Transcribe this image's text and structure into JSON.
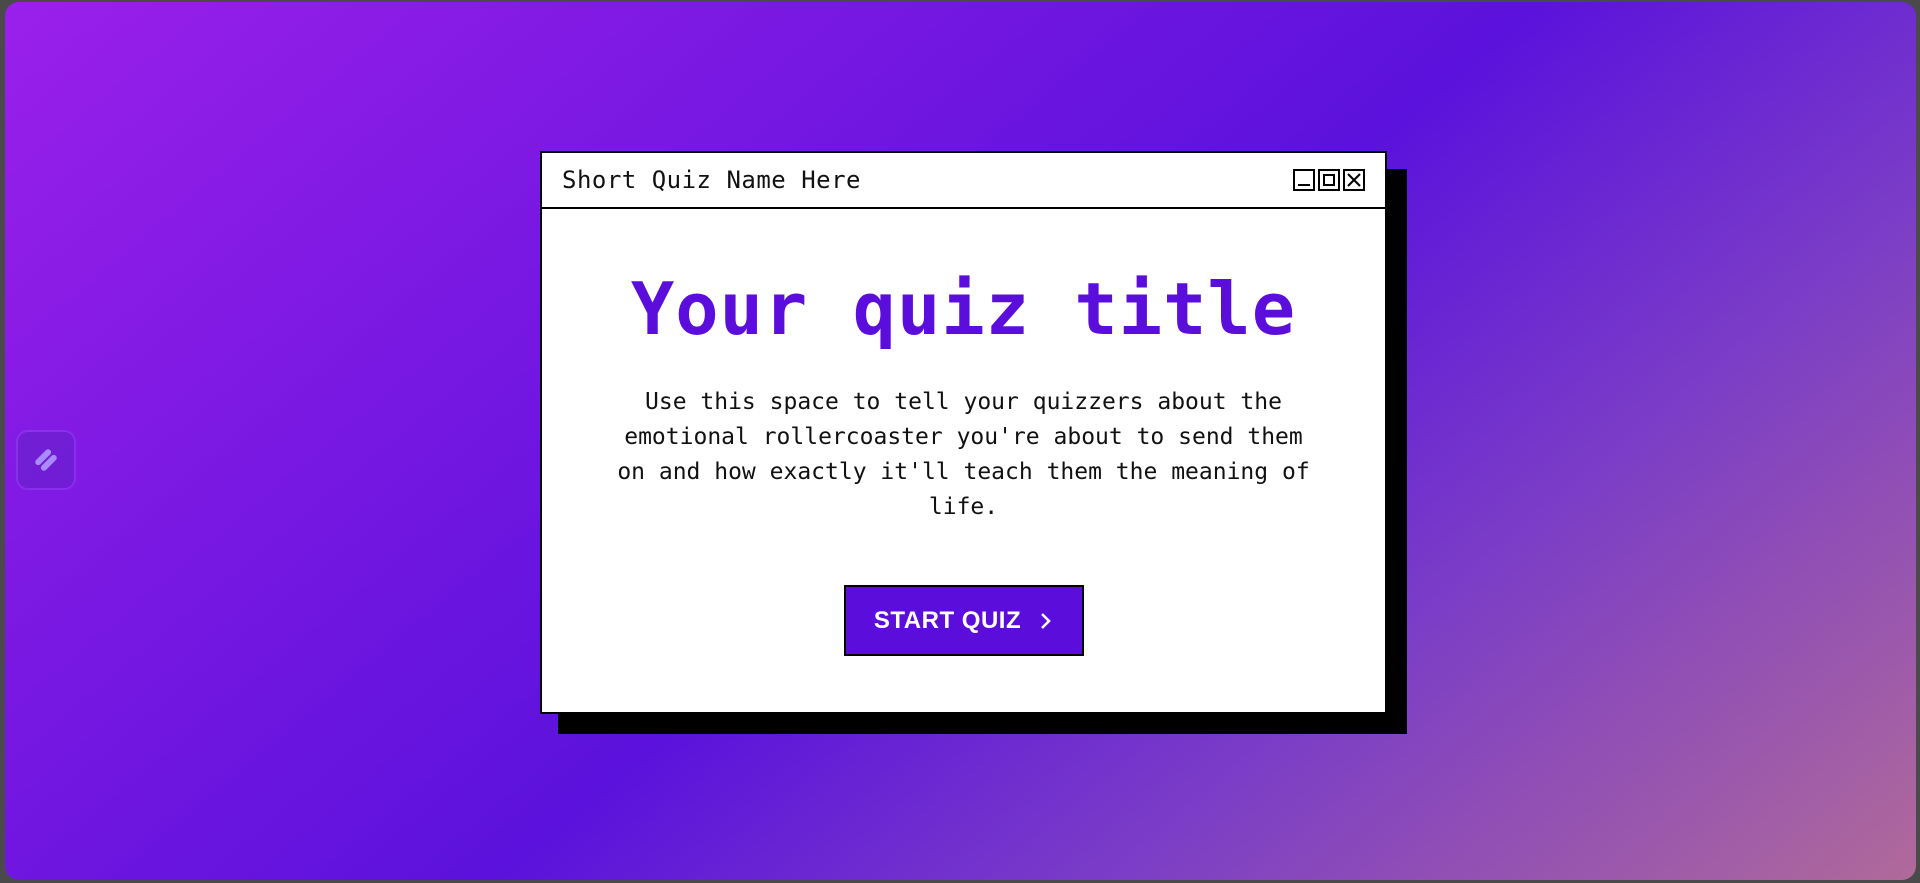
{
  "window": {
    "title": "Short Quiz Name Here",
    "controls": [
      "minimize-icon",
      "maximize-icon",
      "close-icon"
    ]
  },
  "quiz": {
    "title": "Your quiz title",
    "description": "Use this space to tell your quizzers about the emotional rollercoaster you're about to send them on and how exactly it'll teach them the meaning of life.",
    "start_label": "START QUIZ",
    "start_icon": "chevron-right-icon"
  },
  "sidebar": {
    "badge_icon": "logo-icon"
  },
  "colors": {
    "accent": "#5b0ddb",
    "window_bg": "#ffffff",
    "border": "#000000",
    "gradient_start": "#9a20ea",
    "gradient_end": "#b06a9a"
  }
}
